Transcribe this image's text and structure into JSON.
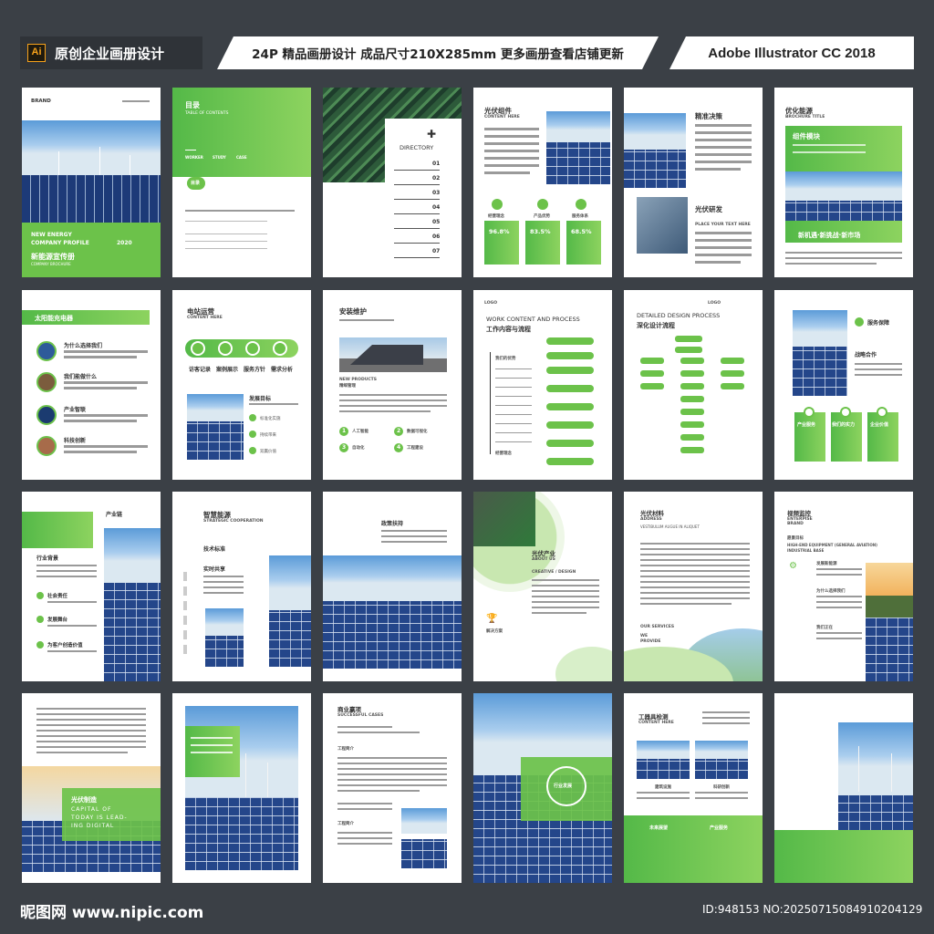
{
  "header": {
    "app_badge": "Ai",
    "left_title": "原创企业画册设计",
    "middle_title": "24P 精品画册设计  成品尺寸210X285mm  更多画册查看店铺更新",
    "right_title": "Adobe Illustrator CC 2018"
  },
  "p1": {
    "brand": "BRAND",
    "en1": "NEW ENERGY",
    "en2": "COMPANY PROFILE",
    "year": "2020",
    "cn": "新能源宣传册",
    "sub": "COMPANY BROCHURE"
  },
  "p2": {
    "title": "目录",
    "sub": "TABLE OF CONTENTS",
    "tabs": [
      "WORKER",
      "STUDY",
      "CASE"
    ],
    "badge": "目录"
  },
  "p3": {
    "title": "DIRECTORY",
    "nums": [
      "01",
      "02",
      "03",
      "04",
      "05",
      "06",
      "07"
    ]
  },
  "p4": {
    "title": "光伏组件",
    "sub": "CONTENT HERE",
    "labels": [
      "经营理念",
      "产品优势",
      "服务体系"
    ],
    "stats": [
      "96.8%",
      "83.5%",
      "68.5%"
    ]
  },
  "p5": {
    "t1": "精准决策",
    "t2": "光伏研发",
    "sub": "PLACE YOUR TEXT HERE"
  },
  "p6": {
    "title": "优化能源",
    "sub": "BROCHURE TITLE",
    "box": "组件模块",
    "banner": "新机遇·新挑战·新市场"
  },
  "p7": {
    "title": "太阳能充电器",
    "items": [
      "为什么选择我们",
      "我们能做什么",
      "产业智联",
      "科技创新"
    ]
  },
  "p8": {
    "title": "电站运营",
    "sub": "CONTENT HERE",
    "icons": [
      "访客记录",
      "案例展示",
      "服务方针",
      "需求分析"
    ],
    "goal": "发展目标",
    "list": [
      "标准化实施",
      "持续带来",
      "双赢价值"
    ]
  },
  "p9": {
    "title": "安装维护",
    "np": "NEW PRODUCTS",
    "np_cn": "精细管理",
    "steps": [
      "人工智能",
      "数据可视化",
      "自动化",
      "工程建设"
    ],
    "nums": [
      "1",
      "2",
      "3",
      "4"
    ]
  },
  "p10": {
    "logo": "LOGO",
    "en": "WORK CONTENT AND PROCESS",
    "cn": "工作内容与流程",
    "side": "我们的优势",
    "foot": "经营理念"
  },
  "p11": {
    "logo": "LOGO",
    "en": "DETAILED DESIGN PROCESS",
    "cn": "深化设计流程"
  },
  "p12": {
    "t1": "服务保障",
    "t2": "战略合作",
    "labels": [
      "产业服务",
      "我们的实力",
      "企业价值"
    ]
  },
  "p13": {
    "t1": "产业链",
    "t2": "行业背景",
    "items": [
      "社会责任",
      "发展舞台",
      "为客户创造价值"
    ]
  },
  "p14": {
    "title": "智慧能源",
    "sub": "STRATEGIC COOPERATION",
    "t2": "技术标准",
    "t3": "实时共享"
  },
  "p15": {
    "title": "政策扶持"
  },
  "p16": {
    "title": "光伏产业",
    "sub": "ABOUT US",
    "sub2": "CREATIVE / DESIGN",
    "foot": "解决方案"
  },
  "p17": {
    "title": "光伏材料",
    "sub": "ADDRESS",
    "sub2": "VESTIBULUM AUGUE IN ALIQUET",
    "svc": "OUR SERVICES",
    "we": "WE",
    "provide": "PROVIDE"
  },
  "p18": {
    "title": "视频监控",
    "sub": "ENTERPISE BRAND",
    "goal": "愿景目标",
    "en": "HIGH-END EQUIPMENT (GENERAL AVIATION)",
    "en2": "INDUSTRIAL BASE",
    "items": [
      "发展新能源",
      "为什么选择我们",
      "我们正在"
    ]
  },
  "p19": {
    "cn": "光伏制造",
    "en1": "CAPITAL OF",
    "en2": "TODAY IS LEAD-",
    "en3": "ING DIGITAL"
  },
  "p21": {
    "title": "商业赢项",
    "sub": "SUCCESSFUL CASES",
    "t2": "工程简介",
    "t3": "工程简介"
  },
  "p22": {
    "label": "行业发展"
  },
  "p23": {
    "title": "工器具检测",
    "sub": "CONTENT HERE",
    "l1": "建筑设施",
    "l2": "科研创新",
    "b1": "未来展望",
    "b2": "产业服务"
  },
  "footer": {
    "site": "昵图网 www.nipic.com",
    "id": "ID:948153 NO:20250715084910204129"
  }
}
